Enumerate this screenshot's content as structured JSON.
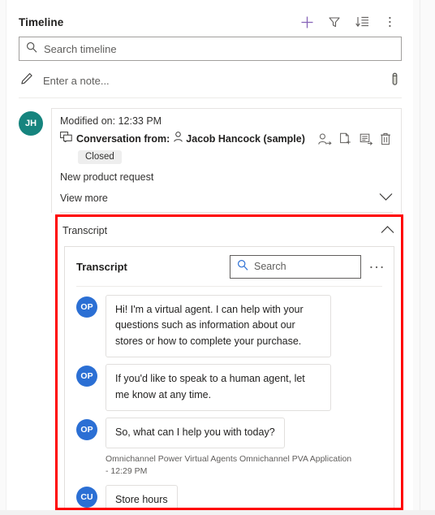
{
  "header": {
    "title": "Timeline",
    "actions": [
      {
        "name": "add-record-button",
        "icon": "plus-icon",
        "label": "+"
      },
      {
        "name": "filter-button",
        "icon": "filter-icon",
        "label": "Filter"
      },
      {
        "name": "sort-button",
        "icon": "sort-descending-icon",
        "label": "Sort"
      },
      {
        "name": "more-commands-button",
        "icon": "more-vertical-icon",
        "label": "More commands"
      }
    ]
  },
  "search": {
    "placeholder": "Search timeline",
    "icon": "search-icon"
  },
  "note": {
    "placeholder": "Enter a note...",
    "pencil_icon": "pencil-icon",
    "attach_icon": "paperclip-icon"
  },
  "record": {
    "avatar_initials": "JH",
    "modified": "Modified on: 12:33 PM",
    "conversation_icon": "conversation-icon",
    "conversation_label": "Conversation from:",
    "person_icon": "person-icon",
    "person": "Jacob Hancock (sample)",
    "status_badge": "Closed",
    "subject": "New product request",
    "view_more": "View more",
    "collapse_icon": "chevron-down-icon",
    "actions": [
      {
        "name": "assign-icon",
        "label": "Assign"
      },
      {
        "name": "add-document-icon",
        "label": "Add document"
      },
      {
        "name": "add-note-icon",
        "label": "Add note"
      },
      {
        "name": "delete-icon",
        "label": "Delete"
      }
    ]
  },
  "transcript_section": {
    "label": "Transcript",
    "expand_icon": "chevron-up-icon",
    "card": {
      "title": "Transcript",
      "search_placeholder": "Search",
      "search_icon": "search-icon",
      "more_icon": "more-horizontal-icon"
    },
    "messages": [
      {
        "avatar": "OP",
        "text": "Hi! I'm a virtual agent. I can help with your questions such as information about our stores or how to complete your purchase.",
        "meta": ""
      },
      {
        "avatar": "OP",
        "text": "If you'd like to speak to a human agent, let me know at any time.",
        "meta": ""
      },
      {
        "avatar": "OP",
        "text": "So, what can I help you with today?",
        "meta": "Omnichannel Power Virtual Agents Omnichannel PVA Application - 12:29 PM"
      },
      {
        "avatar": "CU",
        "text": "Store hours",
        "meta": ""
      }
    ]
  },
  "colors": {
    "highlight_box": "#ff0000",
    "record_avatar": "#16847e",
    "message_avatar": "#2b6fd4",
    "add_icon": "#8764b8"
  }
}
